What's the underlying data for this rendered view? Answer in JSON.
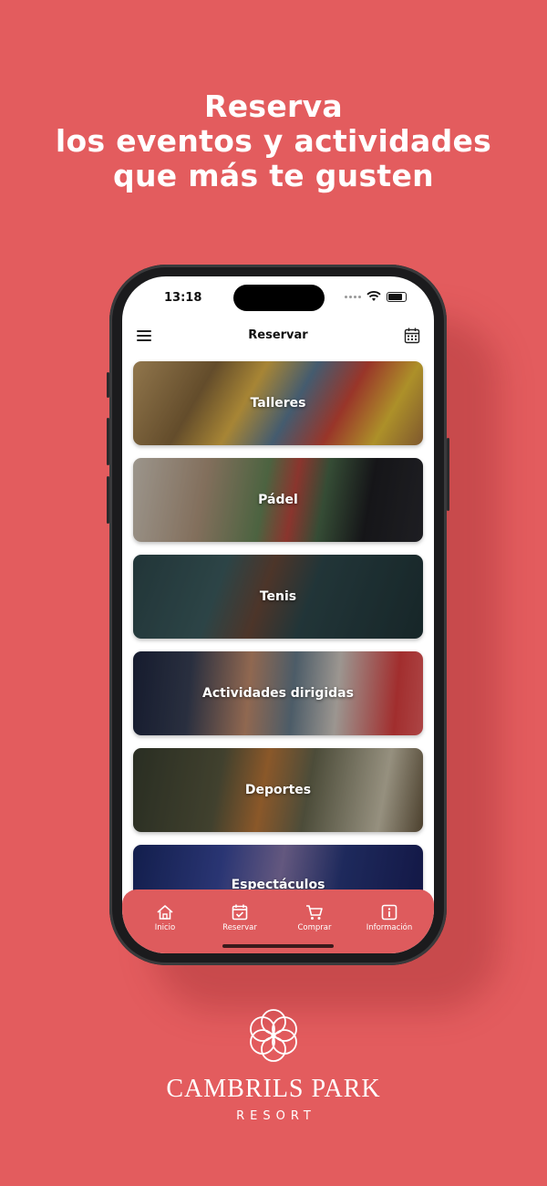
{
  "headline": {
    "line1": "Reserva",
    "line2": "los eventos y actividades",
    "line3": "que más te gusten"
  },
  "status_bar": {
    "time": "13:18"
  },
  "nav": {
    "title": "Reservar"
  },
  "cards": [
    {
      "label": "Talleres"
    },
    {
      "label": "Pádel"
    },
    {
      "label": "Tenis"
    },
    {
      "label": "Actividades dirigidas"
    },
    {
      "label": "Deportes"
    },
    {
      "label": "Espectáculos"
    }
  ],
  "tabs": [
    {
      "label": "Inicio",
      "icon": "home-icon"
    },
    {
      "label": "Reservar",
      "icon": "calendar-check-icon"
    },
    {
      "label": "Comprar",
      "icon": "cart-icon"
    },
    {
      "label": "Información",
      "icon": "info-icon"
    }
  ],
  "brand": {
    "name": "CAMBRILS PARK",
    "sub": "RESORT"
  },
  "colors": {
    "background": "#e35c5e",
    "tabbar": "#de5b5d"
  }
}
